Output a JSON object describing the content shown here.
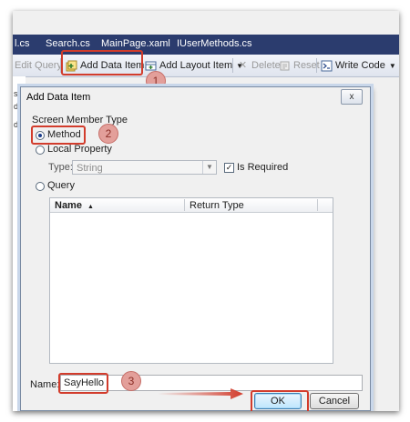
{
  "tabs": [
    {
      "label": "l.cs"
    },
    {
      "label": "Search.cs"
    },
    {
      "label": "MainPage.xaml"
    },
    {
      "label": "IUserMethods.cs"
    }
  ],
  "toolbar": {
    "edit_query": "Edit Query",
    "add_data_item": "Add Data Item...",
    "add_layout_item": "Add Layout Item",
    "delete": "Delete",
    "reset": "Reset",
    "write_code": "Write Code"
  },
  "left_strip": [
    "s",
    "d",
    "di"
  ],
  "badges": {
    "one": "1",
    "two": "2",
    "three": "3"
  },
  "dialog": {
    "title": "Add Data Item",
    "close_label": "x",
    "screen_member_type_label": "Screen Member Type",
    "options": {
      "method": "Method",
      "local_property": "Local Property",
      "query": "Query"
    },
    "selected_option": "method",
    "type_label": "Type:",
    "type_value": "String",
    "is_required_label": "Is Required",
    "is_required_checked": true,
    "grid_columns": {
      "name": "Name",
      "return_type": "Return Type"
    },
    "name_label": "Name:",
    "name_value": "SayHello",
    "ok_label": "OK",
    "cancel_label": "Cancel"
  },
  "colors": {
    "highlight": "#d23c2c",
    "badge": "#e39f9a",
    "tab_bar": "#2b3c6e"
  }
}
